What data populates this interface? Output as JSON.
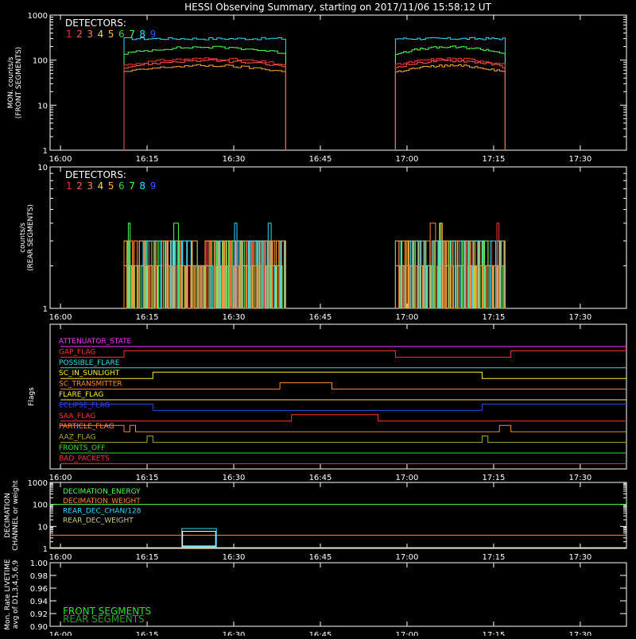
{
  "title": "HESSI Observing Summary, starting on 2017/11/06 15:58:12 UT",
  "time_ticks": [
    "16:00",
    "16:15",
    "16:30",
    "16:45",
    "17:00",
    "17:15",
    "17:30"
  ],
  "detector_colors": [
    "#ff2a2a",
    "#ff5555",
    "#ff8a2a",
    "#ffdd33",
    "#ffb833",
    "#33dd33",
    "#55ff55",
    "#33ddff",
    "#3355ff"
  ],
  "chart_data": [
    {
      "type": "line",
      "panel": "front",
      "ylabel_lines": [
        "MON. counts/s",
        "(FRONT SEGMENTS)"
      ],
      "yscale": "log",
      "ylim": [
        1,
        1000
      ],
      "y_ticks": [
        "1",
        "10",
        "100",
        "1000"
      ],
      "legend_title": "DETECTORS:",
      "legend_items": [
        "1",
        "2",
        "3",
        "4",
        "5",
        "6",
        "7",
        "8",
        "9"
      ],
      "intervals": [
        [
          "16:11",
          "16:39"
        ],
        [
          "16:58",
          "17:17"
        ]
      ],
      "series": [
        {
          "name": "8",
          "color": "#33ddff",
          "level": 300
        },
        {
          "name": "6",
          "color": "#55ff55",
          "level": 180
        },
        {
          "name": "1",
          "color": "#ff3333",
          "level": 100
        },
        {
          "name": "5",
          "color": "#ffaa33",
          "level": 70
        },
        {
          "name": "2",
          "color": "#ff5555",
          "level": 90
        }
      ]
    },
    {
      "type": "line",
      "panel": "rear",
      "ylabel_lines": [
        "counts/s",
        "(REAR SEGMENTS)"
      ],
      "yscale": "log",
      "ylim": [
        1,
        10
      ],
      "y_ticks": [
        "1",
        "10"
      ],
      "legend_title": "DETECTORS:",
      "legend_items": [
        "1",
        "2",
        "3",
        "4",
        "5",
        "6",
        "7",
        "8",
        "9"
      ],
      "intervals": [
        [
          "16:11",
          "16:39"
        ],
        [
          "16:58",
          "17:17"
        ]
      ],
      "levels": [
        2,
        3,
        4
      ]
    },
    {
      "type": "line",
      "panel": "flags",
      "ylabel": "Flags",
      "flags": [
        {
          "name": "ATTENUATOR_STATE",
          "color": "#ff33ff",
          "segments": [
            [
              "16:00",
              "17:38",
              0
            ]
          ]
        },
        {
          "name": "GAP_FLAG",
          "color": "#ff3333",
          "segments": [
            [
              "16:00",
              "16:11",
              0
            ],
            [
              "16:11",
              "16:58",
              1
            ],
            [
              "16:58",
              "17:18",
              0
            ],
            [
              "17:18",
              "17:38",
              1
            ]
          ]
        },
        {
          "name": "POSSIBLE_FLARE",
          "color": "#33dddd",
          "segments": [
            [
              "16:00",
              "17:38",
              0
            ]
          ]
        },
        {
          "name": "SC_IN_SUNLIGHT",
          "color": "#ffee33",
          "segments": [
            [
              "16:00",
              "16:16",
              0
            ],
            [
              "16:16",
              "17:13",
              1
            ],
            [
              "17:13",
              "17:38",
              0
            ]
          ]
        },
        {
          "name": "SC_TRANSMITTER",
          "color": "#ff8833",
          "segments": [
            [
              "16:00",
              "16:38",
              0
            ],
            [
              "16:38",
              "16:47",
              1
            ],
            [
              "16:47",
              "17:38",
              0
            ]
          ]
        },
        {
          "name": "FLARE_FLAG",
          "color": "#ffee33",
          "segments": [
            [
              "16:00",
              "17:38",
              0
            ]
          ]
        },
        {
          "name": "ECLIPSE_FLAG",
          "color": "#3344ff",
          "segments": [
            [
              "16:00",
              "16:16",
              1
            ],
            [
              "16:16",
              "17:13",
              0
            ],
            [
              "17:13",
              "17:38",
              1
            ]
          ]
        },
        {
          "name": "SAA_FLAG",
          "color": "#ff3333",
          "segments": [
            [
              "16:00",
              "16:40",
              0
            ],
            [
              "16:40",
              "16:55",
              1
            ],
            [
              "16:55",
              "17:38",
              0
            ]
          ]
        },
        {
          "name": "PARTICLE_FLAG",
          "color": "#ff8833",
          "segments": [
            [
              "16:00",
              "16:11",
              1
            ],
            [
              "16:11",
              "16:12",
              0
            ],
            [
              "16:12",
              "16:13",
              1
            ],
            [
              "16:13",
              "17:16",
              0
            ],
            [
              "17:16",
              "17:18",
              1
            ],
            [
              "17:18",
              "17:38",
              0
            ]
          ]
        },
        {
          "name": "AAZ_FLAG",
          "color": "#aaaa33",
          "segments": [
            [
              "16:00",
              "16:15",
              0
            ],
            [
              "16:15",
              "16:16",
              1
            ],
            [
              "16:16",
              "17:13",
              0
            ],
            [
              "17:13",
              "17:14",
              1
            ],
            [
              "17:14",
              "17:38",
              0
            ]
          ]
        },
        {
          "name": "FRONTS_OFF",
          "color": "#33dd33",
          "segments": [
            [
              "16:00",
              "17:38",
              0
            ]
          ]
        },
        {
          "name": "BAD_PACKETS",
          "color": "#ff3333",
          "segments": [
            [
              "16:00",
              "17:38",
              0
            ]
          ]
        }
      ]
    },
    {
      "type": "line",
      "panel": "decimation",
      "ylabel_lines": [
        "DECIMATION",
        "CHANNEL or weight"
      ],
      "yscale": "log",
      "ylim": [
        1,
        1000
      ],
      "y_ticks": [
        "1",
        "10",
        "100",
        "1000"
      ],
      "legend_items": [
        {
          "name": "DECIMATION_ENERGY",
          "color": "#55ff55"
        },
        {
          "name": "DECIMATION_WEIGHT",
          "color": "#ff8833"
        },
        {
          "name": "REAR_DEC_CHAN/128",
          "color": "#33ddff"
        },
        {
          "name": "REAR_DEC_WEIGHT",
          "color": "#cccc88"
        }
      ]
    },
    {
      "type": "line",
      "panel": "livetime",
      "ylabel_lines": [
        "Mon. Rate LIVETIME",
        "avg of D1,3,4,5,6,9"
      ],
      "ylim": [
        0.9,
        1.0
      ],
      "y_ticks": [
        "0.90",
        "0.92",
        "0.94",
        "0.96",
        "0.98",
        "1.00"
      ],
      "legend_items": [
        {
          "name": "FRONT SEGMENTS",
          "color": "#33dd33"
        },
        {
          "name": "REAR SEGMENTS",
          "color": "#339933"
        }
      ]
    }
  ]
}
